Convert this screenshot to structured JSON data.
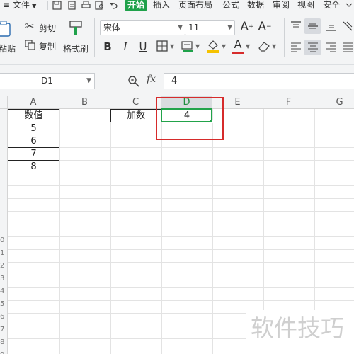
{
  "menubar": {
    "file_label": "文件",
    "tabs": [
      "开始",
      "插入",
      "页面布局",
      "公式",
      "数据",
      "审阅",
      "视图",
      "安全"
    ]
  },
  "ribbon": {
    "paste_label": "粘贴",
    "cut_label": "剪切",
    "copy_label": "复制",
    "format_painter_label": "格式刷",
    "font_name": "宋体",
    "font_size": "11",
    "grow_font": "A⁺",
    "shrink_font": "A⁻",
    "bold": "B",
    "italic": "I",
    "underline": "U",
    "font_color_sample": "A",
    "accent_green": "#1fa14a",
    "font_color": "#d62b2b",
    "fill_color": "#f5c200"
  },
  "formula_bar": {
    "name_box": "D1",
    "zoom_icon": "zoom-icon",
    "fx_label": "fx",
    "value": "4"
  },
  "sheet": {
    "columns": [
      "A",
      "B",
      "C",
      "D",
      "E",
      "F",
      "G"
    ],
    "selected_column": "D",
    "row_headers": [
      "",
      "",
      "",
      "",
      "",
      "",
      "",
      "",
      "",
      "0",
      "1",
      "2",
      "3",
      "4",
      "5",
      "6",
      "7",
      "8",
      "9"
    ],
    "a_header": "数值",
    "a_values": [
      "5",
      "6",
      "7",
      "8"
    ],
    "c1": "加数",
    "d1": "4",
    "selection_color": "#22a34a",
    "highlight_color": "#d62b2b"
  },
  "watermark": "软件技巧"
}
